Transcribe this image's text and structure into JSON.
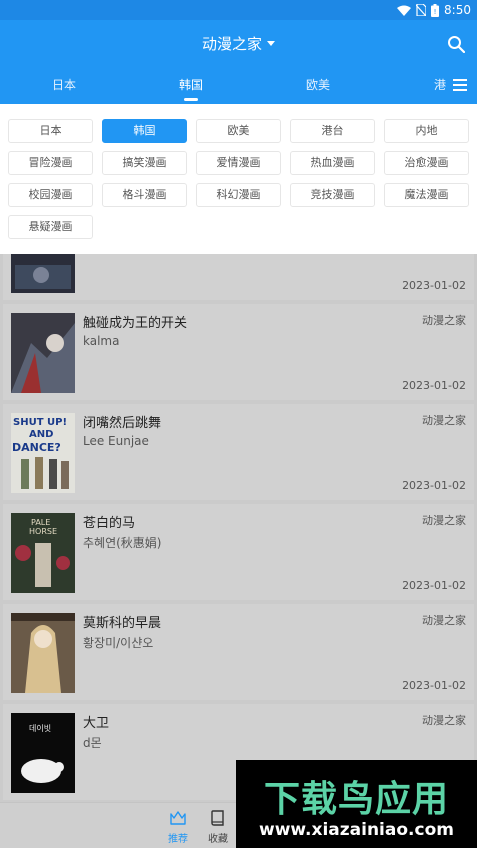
{
  "status_bar": {
    "time": "8:50"
  },
  "app_bar": {
    "title": "动漫之家"
  },
  "tabs": [
    {
      "label": "日本"
    },
    {
      "label": "韩国",
      "active": true
    },
    {
      "label": "欧美"
    },
    {
      "label": "港"
    }
  ],
  "filter_chips": [
    {
      "label": "日本"
    },
    {
      "label": "韩国",
      "selected": true
    },
    {
      "label": "欧美"
    },
    {
      "label": "港台"
    },
    {
      "label": "内地"
    },
    {
      "label": "冒险漫画"
    },
    {
      "label": "搞笑漫画"
    },
    {
      "label": "爱情漫画"
    },
    {
      "label": "热血漫画"
    },
    {
      "label": "治愈漫画"
    },
    {
      "label": "校园漫画"
    },
    {
      "label": "格斗漫画"
    },
    {
      "label": "科幻漫画"
    },
    {
      "label": "竞技漫画"
    },
    {
      "label": "魔法漫画"
    },
    {
      "label": "悬疑漫画"
    }
  ],
  "comics": [
    {
      "name": "",
      "author": "",
      "source": "",
      "date": "2023-01-02"
    },
    {
      "name": "触碰成为王的开关",
      "author": "kalma",
      "source": "动漫之家",
      "date": "2023-01-02"
    },
    {
      "name": "闭嘴然后跳舞",
      "author": "Lee Eunjae",
      "source": "动漫之家",
      "date": "2023-01-02"
    },
    {
      "name": "苍白的马",
      "author": "추혜연(秋惠娟)",
      "source": "动漫之家",
      "date": "2023-01-02"
    },
    {
      "name": "莫斯科的早晨",
      "author": "황장미/이샨오",
      "source": "动漫之家",
      "date": "2023-01-02"
    },
    {
      "name": "大卫",
      "author": "d몬",
      "source": "动漫之家",
      "date": ""
    }
  ],
  "cover_texts": {
    "shut_up": [
      "SHUT UP!",
      "AND",
      "DANCE?"
    ],
    "pale_horse": [
      "PALE",
      "HORSE"
    ],
    "david": "데이빗"
  },
  "bottom_nav": [
    {
      "label": "推荐",
      "icon": "crown-icon",
      "active": true
    },
    {
      "label": "收藏",
      "icon": "book-icon",
      "active": false
    }
  ],
  "watermark": {
    "text": "下载鸟应用",
    "url": "www.xiazainiao.com"
  },
  "colors": {
    "primary": "#2196f3",
    "status_bar": "#1e88e5",
    "overlay_bg": "#cbcbcb",
    "watermark_green": "#5cd3a7"
  }
}
